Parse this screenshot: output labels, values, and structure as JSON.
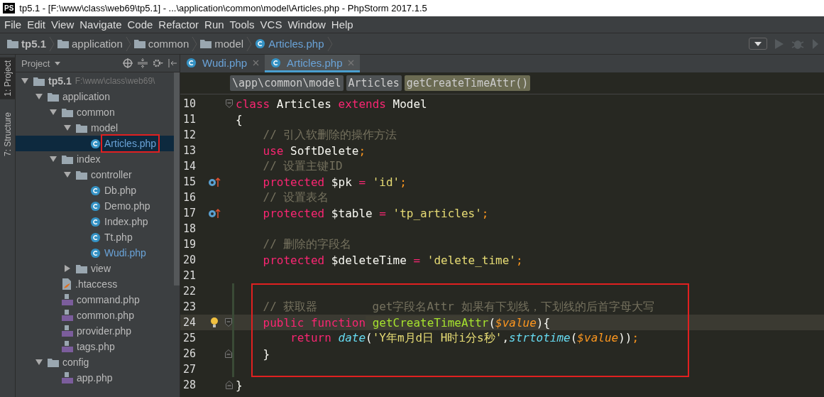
{
  "window": {
    "logo": "PS",
    "title": "tp5.1 - [F:\\www\\class\\web69\\tp5.1] - ...\\application\\common\\model\\Articles.php - PhpStorm 2017.1.5"
  },
  "menu": [
    "File",
    "Edit",
    "View",
    "Navigate",
    "Code",
    "Refactor",
    "Run",
    "Tools",
    "VCS",
    "Window",
    "Help"
  ],
  "nav_bar": [
    {
      "label": "tp5.1",
      "kind": "root"
    },
    {
      "label": "application",
      "kind": "folder"
    },
    {
      "label": "common",
      "kind": "folder"
    },
    {
      "label": "model",
      "kind": "folder"
    },
    {
      "label": "Articles.php",
      "kind": "class"
    }
  ],
  "side_tools": [
    "1: Project",
    "7: Structure"
  ],
  "project_panel": {
    "title": "Project",
    "tree": [
      {
        "label": "tp5.1",
        "path": "F:\\www\\class\\web69\\",
        "kind": "root",
        "expanded": true,
        "children": [
          {
            "label": "application",
            "kind": "folder",
            "expanded": true,
            "children": [
              {
                "label": "common",
                "kind": "folder",
                "expanded": true,
                "children": [
                  {
                    "label": "model",
                    "kind": "folder",
                    "expanded": true,
                    "children": [
                      {
                        "label": "Articles.php",
                        "kind": "class",
                        "selected": true,
                        "modified": true,
                        "boxed": true
                      }
                    ]
                  }
                ]
              },
              {
                "label": "index",
                "kind": "folder",
                "expanded": true,
                "children": [
                  {
                    "label": "controller",
                    "kind": "folder",
                    "expanded": true,
                    "children": [
                      {
                        "label": "Db.php",
                        "kind": "class",
                        "selected": false,
                        "modified": false
                      },
                      {
                        "label": "Demo.php",
                        "kind": "class",
                        "selected": false,
                        "modified": false
                      },
                      {
                        "label": "Index.php",
                        "kind": "class",
                        "selected": false,
                        "modified": false
                      },
                      {
                        "label": "Tt.php",
                        "kind": "class",
                        "selected": false,
                        "modified": false
                      },
                      {
                        "label": "Wudi.php",
                        "kind": "class",
                        "selected": false,
                        "modified": true
                      }
                    ]
                  },
                  {
                    "label": "view",
                    "kind": "folder",
                    "expanded": false
                  }
                ]
              },
              {
                "label": ".htaccess",
                "kind": "file",
                "selected": false
              },
              {
                "label": "command.php",
                "kind": "php",
                "selected": false
              },
              {
                "label": "common.php",
                "kind": "php",
                "selected": false
              },
              {
                "label": "provider.php",
                "kind": "php",
                "selected": false
              },
              {
                "label": "tags.php",
                "kind": "php",
                "selected": false
              }
            ]
          },
          {
            "label": "config",
            "kind": "folder",
            "expanded": true,
            "children": [
              {
                "label": "app.php",
                "kind": "php",
                "selected": false
              }
            ]
          }
        ]
      }
    ]
  },
  "tabs": [
    {
      "label": "Wudi.php",
      "selected": false
    },
    {
      "label": "Articles.php",
      "selected": true
    }
  ],
  "breadcrumbs": [
    "\\app\\common\\model",
    "Articles",
    "getCreateTimeAttr()"
  ],
  "code": [
    {
      "n": "10",
      "markers": [
        {
          "kind": "fold_start"
        }
      ],
      "tokens": [
        {
          "t": "class",
          "kind": "kw"
        },
        {
          "t": " Articles ",
          "kind": "plain"
        },
        {
          "t": "extends",
          "kind": "kw"
        },
        {
          "t": " Model",
          "kind": "plain"
        }
      ]
    },
    {
      "n": "11",
      "tokens": [
        {
          "t": "{",
          "kind": "plain"
        }
      ]
    },
    {
      "n": "12",
      "tokens": [
        {
          "t": "    // 引入软删除的操作方法",
          "kind": "cmt"
        }
      ]
    },
    {
      "n": "13",
      "tokens": [
        {
          "t": "    use",
          "kind": "kw"
        },
        {
          "t": " SoftDelete",
          "kind": "plain"
        },
        {
          "t": ";",
          "kind": "punc"
        }
      ]
    },
    {
      "n": "14",
      "tokens": [
        {
          "t": "    // 设置主键ID",
          "kind": "cmt"
        }
      ]
    },
    {
      "n": "15",
      "markers": [
        {
          "kind": "override"
        }
      ],
      "tokens": [
        {
          "t": "    protected",
          "kind": "kw"
        },
        {
          "t": " $pk ",
          "kind": "plain"
        },
        {
          "t": "=",
          "kind": "kw"
        },
        {
          "t": " 'id'",
          "kind": "str"
        },
        {
          "t": ";",
          "kind": "punc"
        }
      ]
    },
    {
      "n": "16",
      "tokens": [
        {
          "t": "    // 设置表名",
          "kind": "cmt"
        }
      ]
    },
    {
      "n": "17",
      "markers": [
        {
          "kind": "override"
        }
      ],
      "tokens": [
        {
          "t": "    protected",
          "kind": "kw"
        },
        {
          "t": " $table ",
          "kind": "plain"
        },
        {
          "t": "=",
          "kind": "kw"
        },
        {
          "t": " 'tp_articles'",
          "kind": "str"
        },
        {
          "t": ";",
          "kind": "punc"
        }
      ]
    },
    {
      "n": "18"
    },
    {
      "n": "19",
      "tokens": [
        {
          "t": "    // 删除的字段名",
          "kind": "cmt"
        }
      ]
    },
    {
      "n": "20",
      "tokens": [
        {
          "t": "    protected",
          "kind": "kw"
        },
        {
          "t": " $deleteTime ",
          "kind": "plain"
        },
        {
          "t": "=",
          "kind": "kw"
        },
        {
          "t": " 'delete_time'",
          "kind": "str"
        },
        {
          "t": ";",
          "kind": "punc"
        }
      ]
    },
    {
      "n": "21"
    },
    {
      "n": "22",
      "boxed": true
    },
    {
      "n": "23",
      "boxed": true,
      "tokens": [
        {
          "t": "    // 获取器        get字段名Attr 如果有下划线，下划线的后首字母大写",
          "kind": "cmt"
        }
      ]
    },
    {
      "n": "24",
      "boxed": true,
      "current": true,
      "markers": [
        {
          "kind": "bulb"
        },
        {
          "kind": "fold_start"
        }
      ],
      "tokens": [
        {
          "t": "    public",
          "kind": "kw"
        },
        {
          "t": " function",
          "kind": "kw"
        },
        {
          "t": " getCreateTimeAttr",
          "kind": "def"
        },
        {
          "t": "(",
          "kind": "plain"
        },
        {
          "t": "$value",
          "kind": "var"
        },
        {
          "t": "){",
          "kind": "plain"
        }
      ]
    },
    {
      "n": "25",
      "boxed": true,
      "tokens": [
        {
          "t": "        return",
          "kind": "kw"
        },
        {
          "t": " date",
          "kind": "call"
        },
        {
          "t": "(",
          "kind": "plain"
        },
        {
          "t": "'Y年m月d日 H时i分s秒'",
          "kind": "str"
        },
        {
          "t": ",",
          "kind": "plain"
        },
        {
          "t": "strtotime",
          "kind": "call"
        },
        {
          "t": "(",
          "kind": "plain"
        },
        {
          "t": "$value",
          "kind": "var"
        },
        {
          "t": "))",
          "kind": "plain"
        },
        {
          "t": ";",
          "kind": "punc"
        }
      ]
    },
    {
      "n": "26",
      "boxed": true,
      "markers": [
        {
          "kind": "fold_end"
        }
      ],
      "tokens": [
        {
          "t": "    }",
          "kind": "plain"
        }
      ]
    },
    {
      "n": "27",
      "boxed": true
    },
    {
      "n": "28",
      "markers": [
        {
          "kind": "fold_end"
        }
      ],
      "tokens": [
        {
          "t": "}",
          "kind": "plain"
        }
      ]
    }
  ]
}
